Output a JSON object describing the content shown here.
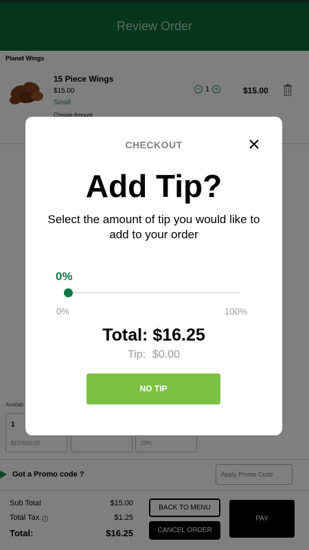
{
  "header": {
    "title": "Review Order"
  },
  "store": {
    "name": "Planet Wings"
  },
  "item": {
    "name": "15 Piece Wings",
    "price": "$15.00",
    "size": "Small",
    "choose_label": "Choose Amount",
    "quantity": "1",
    "line_total": "$15.00",
    "image_icon": "chicken-wings-image"
  },
  "tip_section": {
    "available_label": "Availab",
    "boxes": [
      {
        "value": "1",
        "sub": "$100000.00"
      },
      {
        "value": "",
        "sub": ""
      },
      {
        "value": "",
        "sub": "20%"
      }
    ]
  },
  "promo": {
    "label": "Got a Promo code ?",
    "placeholder": "Apply Promo Code"
  },
  "summary": {
    "subtotal_label": "Sub Total",
    "subtotal_value": "$15.00",
    "tax_label": "Total Tax",
    "tax_value": "$1.25",
    "total_label": "Total:",
    "total_value": "$16.25"
  },
  "actions": {
    "back_to_menu": "BACK TO MENU",
    "cancel_order": "CANCEL ORDER",
    "pay": "PAY"
  },
  "modal": {
    "header": "CHECKOUT",
    "title": "Add Tip?",
    "subtitle": "Select the amount of tip you would like to add to your order",
    "selected_percent": "0%",
    "slider_value": 0,
    "slider_min_label": "0%",
    "slider_max_label": "100%",
    "total_text": "Total: $16.25",
    "tip_label": "Tip:",
    "tip_value": "$0.00",
    "button_label": "NO TIP"
  },
  "colors": {
    "header_bg": "#0a6b3a",
    "accent_green": "#0a7a45",
    "no_tip_button": "#7cc140"
  }
}
